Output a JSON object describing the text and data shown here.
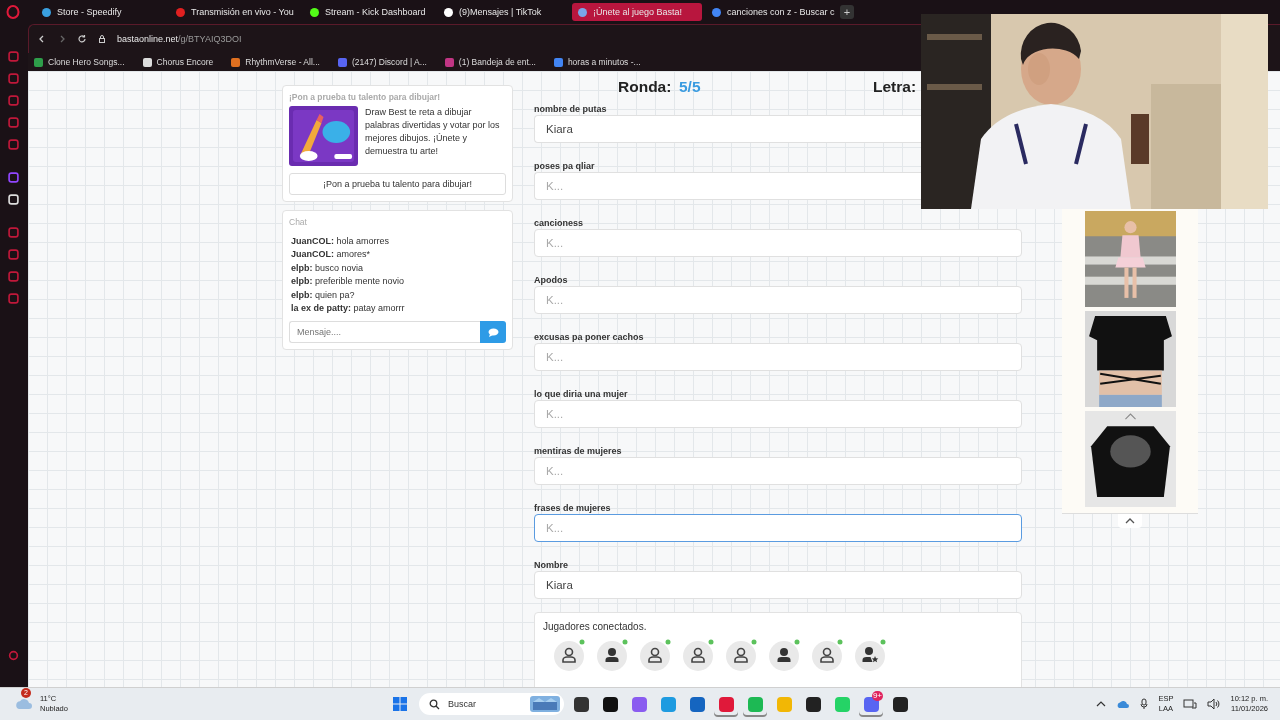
{
  "browser": {
    "tabs": [
      {
        "title": "Store - Speedify",
        "selected": false,
        "color": "#3aa0e0"
      },
      {
        "title": "Transmisión en vivo - You",
        "selected": false,
        "color": "#e02020"
      },
      {
        "title": "Stream - Kick Dashboard",
        "selected": false,
        "color": "#53fc18"
      },
      {
        "title": "(9)Mensajes | TikTok",
        "selected": false,
        "color": "#ffffff"
      },
      {
        "title": "¡Únete al juego Basta!",
        "selected": true,
        "color": "#7aa6e8"
      },
      {
        "title": "canciones con z - Buscar c",
        "selected": false,
        "color": "#4285f4"
      }
    ],
    "new_tab": "+",
    "address": {
      "host": "bastaonline.net",
      "path": "/g/BTYAIQ3DOI"
    },
    "bookmarks": [
      {
        "title": "Clone Hero Songs...",
        "color": "#2e9e4a"
      },
      {
        "title": "Chorus Encore",
        "color": "#dddddd"
      },
      {
        "title": "RhythmVerse - All...",
        "color": "#e07020"
      },
      {
        "title": "(2147) Discord | A...",
        "color": "#5865f2"
      },
      {
        "title": "(1) Bandeja de ent...",
        "color": "#c13584"
      },
      {
        "title": "horas a minutos -...",
        "color": "#4285f4"
      }
    ]
  },
  "promo": {
    "heading": "¡Pon a prueba tu talento para dibujar!",
    "text": "Draw Best te reta a dibujar palabras divertidas y votar por los mejores dibujos. ¡Únete y demuestra tu arte!",
    "button": "¡Pon a prueba tu talento para dibujar!"
  },
  "chat": {
    "title": "Chat",
    "messages": [
      {
        "user": "JuanCOL:",
        "text": "hola amorres"
      },
      {
        "user": "JuanCOL:",
        "text": "amores*"
      },
      {
        "user": "elpb:",
        "text": "busco novia"
      },
      {
        "user": "elpb:",
        "text": "preferible mente novio"
      },
      {
        "user": "elpb:",
        "text": "quien pa?"
      },
      {
        "user": "la ex de patty:",
        "text": "patay amorrr"
      }
    ],
    "input": {
      "placeholder": "Mensaje...."
    }
  },
  "game": {
    "round_label": "Ronda:",
    "round_value": "5/5",
    "letter_label": "Letra:",
    "fields": [
      {
        "label": "nombre de putas",
        "value": "Kiara",
        "focused": false
      },
      {
        "label": "poses pa qliar",
        "placeholder": "K...",
        "focused": false
      },
      {
        "label": "cancioness",
        "placeholder": "K...",
        "focused": false
      },
      {
        "label": "Apodos",
        "placeholder": "K...",
        "focused": false
      },
      {
        "label": "excusas pa poner cachos",
        "placeholder": "K...",
        "focused": false
      },
      {
        "label": "lo que diria una mujer",
        "placeholder": "K...",
        "focused": false
      },
      {
        "label": "mentiras de mujeres",
        "placeholder": "K...",
        "focused": false
      },
      {
        "label": "frases de mujeres",
        "placeholder": "K...",
        "focused": true
      },
      {
        "label": "Nombre",
        "value": "Kiara",
        "focused": false
      }
    ],
    "players_title": "Jugadores conectados.",
    "players": [
      {
        "kind": "outline",
        "online": true
      },
      {
        "kind": "solid",
        "online": true
      },
      {
        "kind": "outline",
        "online": true
      },
      {
        "kind": "outline",
        "online": true
      },
      {
        "kind": "outline",
        "online": true
      },
      {
        "kind": "solid",
        "online": true
      },
      {
        "kind": "outline",
        "online": true
      },
      {
        "kind": "star",
        "online": true
      }
    ]
  },
  "taskbar": {
    "weather": {
      "temp": "11°C",
      "condition": "Nublado",
      "badge": "2"
    },
    "search": "Buscar",
    "apps": [
      {
        "color": "#333333",
        "running": false
      },
      {
        "color": "#111111",
        "running": false
      },
      {
        "color": "#8a5cf0",
        "running": false
      },
      {
        "color": "#1e9be0",
        "running": false
      },
      {
        "color": "#1565c0",
        "running": false
      },
      {
        "color": "#e0193a",
        "running": true
      },
      {
        "color": "#1db954",
        "running": true
      },
      {
        "color": "#f2b705",
        "running": false
      },
      {
        "color": "#222222",
        "running": false
      },
      {
        "color": "#25d366",
        "running": false
      },
      {
        "color": "#5865f2",
        "running": true
      },
      {
        "color": "#222222",
        "running": false
      }
    ],
    "discord_badge": "9+",
    "lang": "ESP",
    "layout": "LAA",
    "time": "10:12 p. m.",
    "date": "11/01/2026"
  }
}
